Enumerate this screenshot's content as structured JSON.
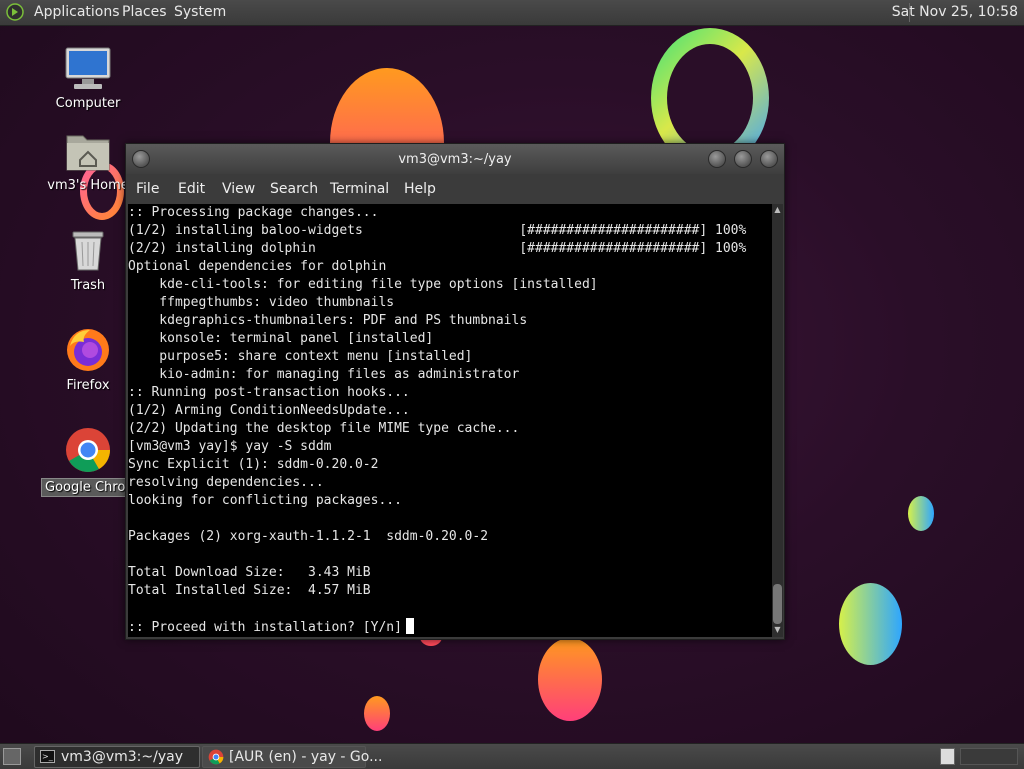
{
  "top_panel": {
    "menus": [
      "Applications",
      "Places",
      "System"
    ],
    "clock": "Sat Nov 25, 10:58"
  },
  "desktop_icons": [
    {
      "label": "Computer",
      "icon": "computer-icon"
    },
    {
      "label": "vm3's Home",
      "icon": "home-folder-icon"
    },
    {
      "label": "Trash",
      "icon": "trash-icon"
    },
    {
      "label": "Firefox",
      "icon": "firefox-icon"
    },
    {
      "label": "Google Chrome",
      "icon": "chrome-icon"
    }
  ],
  "window": {
    "title": "vm3@vm3:~/yay",
    "menu": [
      "File",
      "Edit",
      "View",
      "Search",
      "Terminal",
      "Help"
    ]
  },
  "terminal": {
    "lines": [
      ":: Processing package changes...",
      "(1/2) installing baloo-widgets                    [######################] 100%",
      "(2/2) installing dolphin                          [######################] 100%",
      "Optional dependencies for dolphin",
      "    kde-cli-tools: for editing file type options [installed]",
      "    ffmpegthumbs: video thumbnails",
      "    kdegraphics-thumbnailers: PDF and PS thumbnails",
      "    konsole: terminal panel [installed]",
      "    purpose5: share context menu [installed]",
      "    kio-admin: for managing files as administrator",
      ":: Running post-transaction hooks...",
      "(1/2) Arming ConditionNeedsUpdate...",
      "(2/2) Updating the desktop file MIME type cache...",
      "[vm3@vm3 yay]$ yay -S sddm",
      "Sync Explicit (1): sddm-0.20.0-2",
      "resolving dependencies...",
      "looking for conflicting packages...",
      "",
      "Packages (2) xorg-xauth-1.1.2-1  sddm-0.20.0-2",
      "",
      "Total Download Size:   3.43 MiB",
      "Total Installed Size:  4.57 MiB",
      ""
    ],
    "prompt": ":: Proceed with installation? [Y/n]"
  },
  "taskbar": {
    "tasks": [
      {
        "label": "vm3@vm3:~/yay",
        "icon": "terminal-icon"
      },
      {
        "label": "[AUR (en) - yay - Go...",
        "icon": "chrome-icon"
      }
    ]
  },
  "colors": {
    "wallpaper": "#2a0e28",
    "terminal_bg": "#000000",
    "panel": "#3f3f3f"
  }
}
